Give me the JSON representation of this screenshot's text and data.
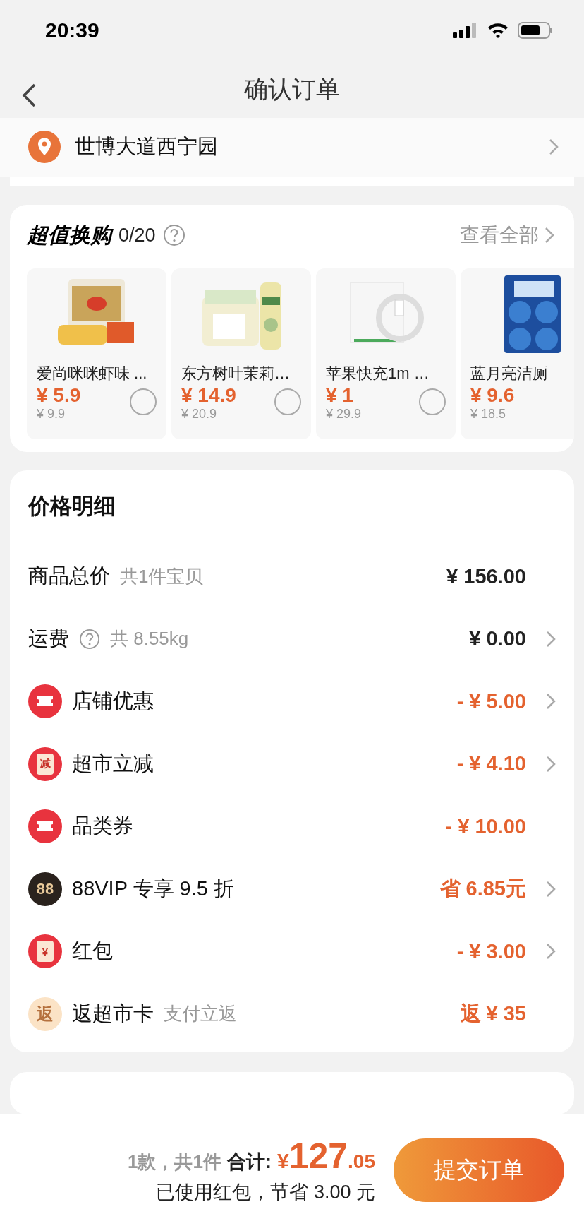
{
  "status_bar": {
    "time": "20:39"
  },
  "nav": {
    "title": "确认订单"
  },
  "address": {
    "text": "世博大道西宁园"
  },
  "exchange": {
    "title": "超值换购",
    "count": "0/20",
    "link": "查看全部",
    "products": [
      {
        "name": "爱尚咪咪虾味 ...",
        "price": "¥ 5.9",
        "original": "¥ 9.9",
        "selected": false,
        "kind": "snack"
      },
      {
        "name": "东方树叶茉莉…",
        "price": "¥ 14.9",
        "original": "¥ 20.9",
        "selected": false,
        "kind": "drink"
      },
      {
        "name": "苹果快充1m …",
        "price": "¥ 1",
        "original": "¥ 29.9",
        "selected": false,
        "kind": "cable"
      },
      {
        "name": "蓝月亮洁厕",
        "price": "¥ 9.6",
        "original": "¥ 18.5",
        "kind": "cleaner"
      }
    ]
  },
  "price_detail": {
    "title": "价格明细",
    "rows": [
      {
        "kind": "plain",
        "label": "商品总价",
        "note": "共1件宝贝",
        "value": "¥ 156.00",
        "chevron": false
      },
      {
        "kind": "help",
        "label": "运费",
        "note": "共 8.55kg",
        "value": "¥ 0.00",
        "chevron": true
      },
      {
        "kind": "ticket",
        "label": "店铺优惠",
        "value": "- ¥ 5.00",
        "chevron": true
      },
      {
        "kind": "badge",
        "icon_text": "减",
        "label": "超市立减",
        "value": "- ¥ 4.10",
        "chevron": true
      },
      {
        "kind": "ticket",
        "label": "品类券",
        "value": "- ¥ 10.00",
        "chevron": false
      },
      {
        "kind": "vip",
        "icon_text": "88",
        "label": "88VIP 专享 9.5 折",
        "value": "省 6.85元",
        "chevron": true
      },
      {
        "kind": "badge",
        "icon_text": "¥",
        "label": "红包",
        "value": "- ¥ 3.00",
        "chevron": true
      },
      {
        "kind": "rebate",
        "icon_text": "返",
        "label": "返超市卡",
        "note": "支付立返",
        "value": "返 ¥ 35",
        "chevron": false
      }
    ]
  },
  "footer": {
    "count": "1款，共1件",
    "total_label": "合计:",
    "currency": "¥",
    "total_int": "127",
    "total_dec": ".05",
    "saving": "已使用红包，节省 3.00 元",
    "submit": "提交订单"
  }
}
